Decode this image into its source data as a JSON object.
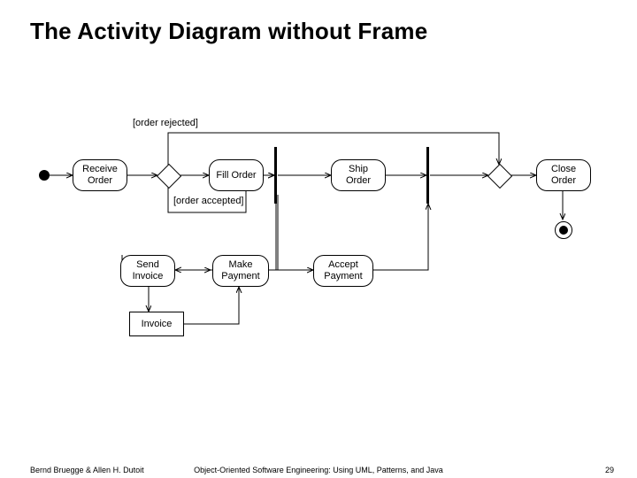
{
  "title": "The Activity Diagram without Frame",
  "footer": {
    "left": "Bernd Bruegge & Allen H. Dutoit",
    "center": "Object-Oriented Software Engineering: Using UML, Patterns, and Java",
    "right": "29"
  },
  "diagram": {
    "activities": {
      "receive": "Receive\nOrder",
      "fill": "Fill\nOrder",
      "ship": "Ship\nOrder",
      "close": "Close\nOrder",
      "send_invoice": "Send\nInvoice",
      "make_payment": "Make\nPayment",
      "accept_payment": "Accept\nPayment"
    },
    "object": "Invoice",
    "guards": {
      "rejected": "[order\nrejected]",
      "accepted": "[order\naccepted]"
    }
  }
}
